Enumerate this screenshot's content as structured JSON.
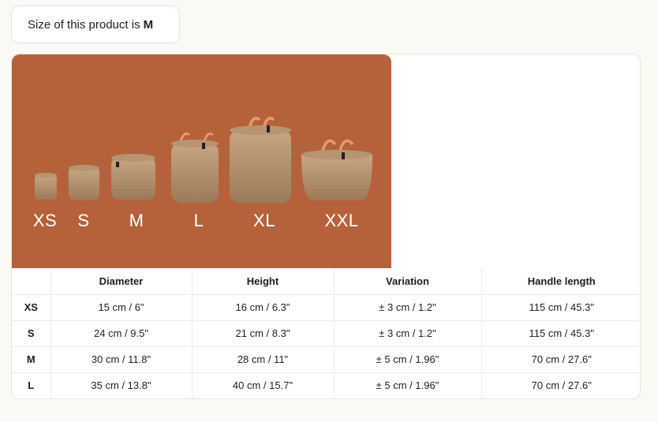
{
  "size_info": {
    "prefix": "Size of this product is",
    "value": "M"
  },
  "image": {
    "background_color": "#b5623c",
    "size_labels": [
      "XS",
      "S",
      "M",
      "L",
      "XL",
      "XXL"
    ]
  },
  "table": {
    "columns": [
      "",
      "Diameter",
      "Height",
      "Variation",
      "Handle length"
    ],
    "rows": [
      {
        "size": "XS",
        "diameter": "15 cm / 6\"",
        "height": "16 cm / 6.3\"",
        "variation": "± 3 cm / 1.2\"",
        "handle": "115 cm / 45.3\""
      },
      {
        "size": "S",
        "diameter": "24 cm / 9.5\"",
        "height": "21 cm / 8.3\"",
        "variation": "± 3 cm / 1.2\"",
        "handle": "115 cm / 45.3\""
      },
      {
        "size": "M",
        "diameter": "30 cm / 11.8\"",
        "height": "28 cm / 11\"",
        "variation": "± 5 cm / 1.96\"",
        "handle": "70 cm / 27.6\""
      },
      {
        "size": "L",
        "diameter": "35 cm / 13.8\"",
        "height": "40 cm / 15.7\"",
        "variation": "± 5 cm / 1.96\"",
        "handle": "70 cm / 27.6\""
      }
    ]
  }
}
